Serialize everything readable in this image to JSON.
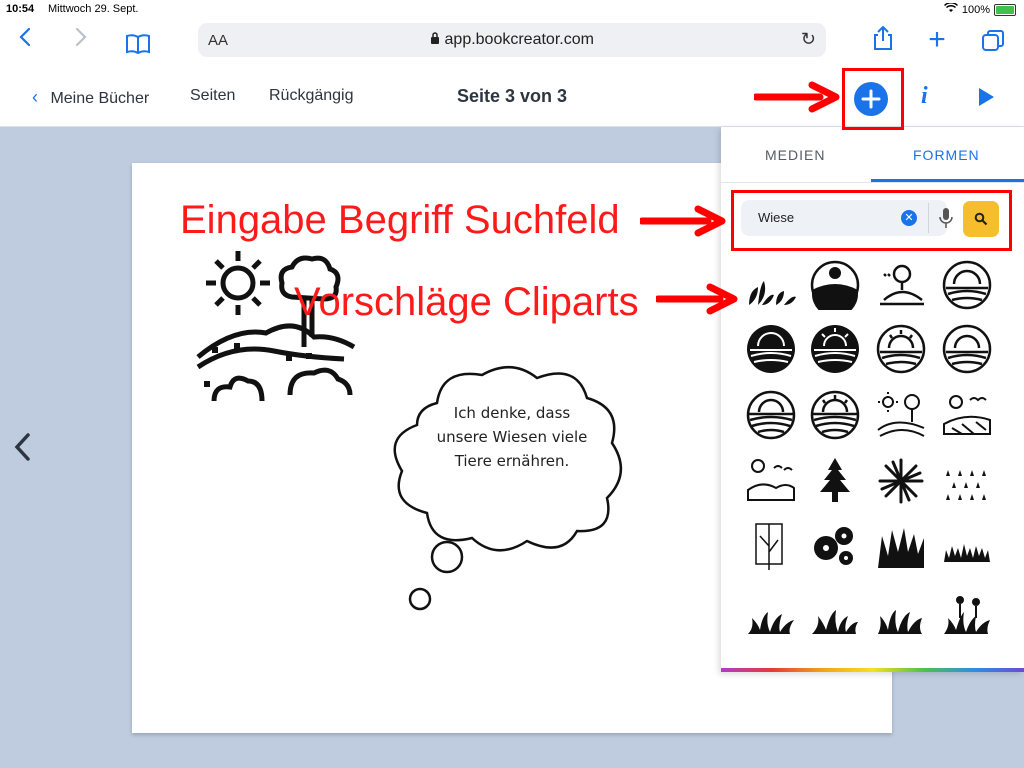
{
  "status": {
    "time": "10:54",
    "date": "Mittwoch 29. Sept.",
    "battery": "100%"
  },
  "browser": {
    "aa": "AA",
    "url": "app.bookcreator.com"
  },
  "appbar": {
    "back_label": "Meine Bücher",
    "pages_label": "Seiten",
    "undo_label": "Rückgängig",
    "title": "Seite 3 von 3"
  },
  "page": {
    "bubble_text": "Ich denke, dass unsere Wiesen viele Tiere ernähren."
  },
  "panel": {
    "tabs": [
      {
        "label": "MEDIEN",
        "active": false
      },
      {
        "label": "FORMEN",
        "active": true
      }
    ],
    "search_value": "Wiese"
  },
  "annotations": {
    "search_label": "Eingabe Begriff Suchfeld",
    "clipart_label": "Vorschläge Cliparts"
  },
  "colors": {
    "accent": "#1a73e8",
    "annotation": "#ff0000",
    "search_button": "#f6bd2c",
    "workspace": "#bfcce0"
  },
  "clipart_icons": [
    "leaves-icon",
    "meadow-circle-icon",
    "tree-hill-icon",
    "sunrise-circle-icon",
    "sunrise-filled-icon",
    "sunrise-filled-icon",
    "sunrise-outline-icon",
    "sunrise-outline-icon",
    "sunrise-field-icon",
    "sunrise-field-icon",
    "sun-tree-hill-icon",
    "sun-field-icon",
    "sun-dunes-icon",
    "pine-tree-icon",
    "grass-burst-icon",
    "rain-grass-icon",
    "tree-outline-icon",
    "flowers-icon",
    "grass-tuft-icon",
    "grass-strip-icon",
    "grass-small-icon",
    "grass-small-icon",
    "grass-small-icon",
    "grass-flowers-icon"
  ]
}
